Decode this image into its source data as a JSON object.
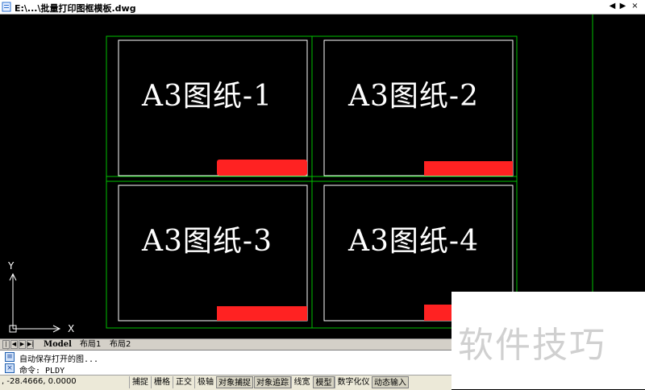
{
  "window": {
    "title": "E:\\...\\批量打印图框模板.dwg",
    "controls": [
      "◀",
      "▶",
      "×"
    ]
  },
  "drawing": {
    "sheets": [
      {
        "label": "A3图纸-1"
      },
      {
        "label": "A3图纸-2"
      },
      {
        "label": "A3图纸-3"
      },
      {
        "label": "A3图纸-4"
      }
    ],
    "ucs": {
      "x_label": "X",
      "y_label": "Y"
    },
    "colors": {
      "frame_outer": "#00c000",
      "frame_inner": "#ffffff",
      "redaction": "#ff2222",
      "background": "#000000"
    }
  },
  "layout_tabs": {
    "nav": [
      "|◀",
      "◀",
      "▶",
      "▶|"
    ],
    "tabs": [
      {
        "label": "Model",
        "active": true
      },
      {
        "label": "布局1",
        "active": false
      },
      {
        "label": "布局2",
        "active": false
      }
    ]
  },
  "command": {
    "lines": [
      "自动保存打开的图...",
      "命令: PLDY"
    ]
  },
  "status": {
    "coords": ", -28.4666, 0.0000",
    "buttons": [
      {
        "label": "捕捉",
        "on": false
      },
      {
        "label": "栅格",
        "on": false
      },
      {
        "label": "正交",
        "on": false
      },
      {
        "label": "极轴",
        "on": false
      },
      {
        "label": "对象捕捉",
        "on": true
      },
      {
        "label": "对象追踪",
        "on": true
      },
      {
        "label": "线宽",
        "on": false
      },
      {
        "label": "模型",
        "on": true
      },
      {
        "label": "数字化仪",
        "on": false
      },
      {
        "label": "动态输入",
        "on": true
      }
    ]
  },
  "watermark": {
    "text": "软件技巧"
  }
}
